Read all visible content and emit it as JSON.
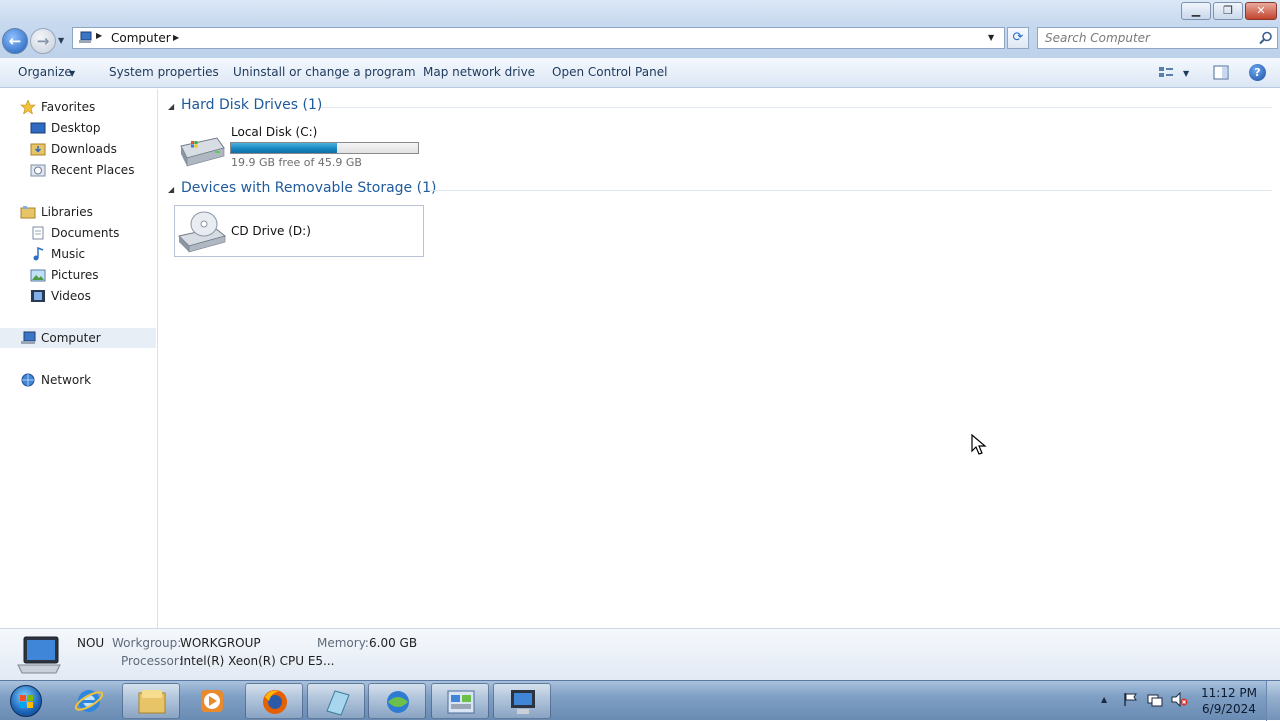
{
  "window": {
    "minimize_glyph": "▁",
    "maximize_glyph": "❐",
    "close_glyph": "✕"
  },
  "nav": {
    "back_glyph": "←",
    "forward_glyph": "→",
    "history_glyph": "▼"
  },
  "address": {
    "sep": "▶",
    "crumb": "Computer",
    "dropdown_glyph": "▼",
    "refresh_glyph": "⟳"
  },
  "search": {
    "placeholder": "Search Computer"
  },
  "commands": {
    "organize": "Organize",
    "organize_arrow": "▼",
    "system_properties": "System properties",
    "uninstall": "Uninstall or change a program",
    "map_drive": "Map network drive",
    "control_panel": "Open Control Panel",
    "view_arrow": "▼",
    "help_glyph": "?"
  },
  "sidebar": {
    "favorites": "Favorites",
    "desktop": "Desktop",
    "downloads": "Downloads",
    "recent_places": "Recent Places",
    "libraries": "Libraries",
    "documents": "Documents",
    "music": "Music",
    "pictures": "Pictures",
    "videos": "Videos",
    "computer": "Computer",
    "network": "Network"
  },
  "groups": {
    "hdd": {
      "title": "Hard Disk Drives (1)",
      "toggle": "◢"
    },
    "removable": {
      "title": "Devices with Removable Storage (1)",
      "toggle": "◢"
    }
  },
  "drives": {
    "c": {
      "name": "Local Disk (C:)",
      "free_text": "19.9 GB free of 45.9 GB",
      "used_fraction": 0.566
    },
    "d": {
      "name": "CD Drive (D:)"
    }
  },
  "details": {
    "name": "NOU",
    "workgroup_label": "Workgroup:",
    "workgroup_value": "WORKGROUP",
    "memory_label": "Memory:",
    "memory_value": "6.00 GB",
    "processor_label": "Processor:",
    "processor_value": "Intel(R) Xeon(R) CPU E5..."
  },
  "taskbar": {
    "tray_show_glyph": "▲",
    "time": "11:12 PM",
    "date": "6/9/2024"
  },
  "colors": {
    "accent": "#1e5a9c",
    "progress": "#1888c2"
  }
}
